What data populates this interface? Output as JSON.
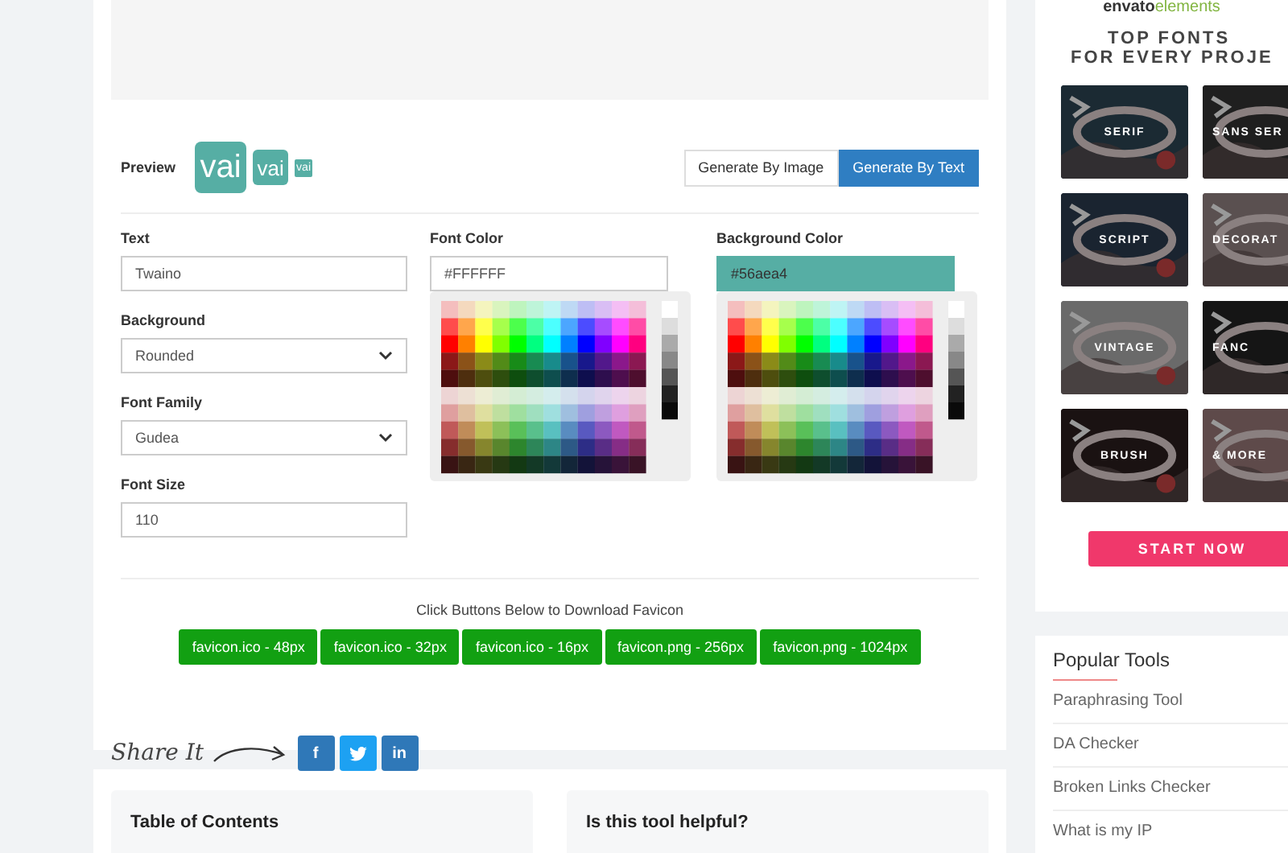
{
  "preview": {
    "label": "Preview",
    "icons": [
      "vai",
      "vai",
      "vai"
    ]
  },
  "mode_tabs": [
    {
      "label": "Generate By Image",
      "selected": false
    },
    {
      "label": "Generate By Text",
      "selected": true
    }
  ],
  "form": {
    "text": {
      "label": "Text",
      "value": "Twaino"
    },
    "background": {
      "label": "Background",
      "value": "Rounded"
    },
    "font_family": {
      "label": "Font Family",
      "value": "Gudea"
    },
    "font_size": {
      "label": "Font Size",
      "value": "110"
    },
    "font_color": {
      "label": "Font Color",
      "value": "#FFFFFF"
    },
    "background_color": {
      "label": "Background Color",
      "value": "#56aea4"
    }
  },
  "download": {
    "hint": "Click Buttons Below to Download Favicon",
    "buttons": [
      "favicon.ico - 48px",
      "favicon.ico - 32px",
      "favicon.ico - 16px",
      "favicon.png - 256px",
      "favicon.png - 1024px"
    ]
  },
  "share": {
    "label": "Share It",
    "buttons": [
      {
        "kind": "facebook",
        "label": "f"
      },
      {
        "kind": "twitter"
      },
      {
        "kind": "linkedin",
        "label": "in"
      }
    ]
  },
  "bottom_cards": [
    "Table of Contents",
    "Is this tool helpful?"
  ],
  "ad": {
    "logo": [
      "envato",
      "elements"
    ],
    "headline": [
      "TOP FONTS",
      "FOR EVERY PROJE"
    ],
    "tiles": [
      {
        "label": "SERIF"
      },
      {
        "label": "SANS SER"
      },
      {
        "label": "SCRIPT"
      },
      {
        "label": "DECORAT"
      },
      {
        "label": "VINTAGE"
      },
      {
        "label": "FANC"
      },
      {
        "label": "BRUSH"
      },
      {
        "label": "& MORE"
      }
    ],
    "button": "START NOW"
  },
  "popular_tools": {
    "title": "Popular Tools",
    "items": [
      "Paraphrasing Tool",
      "DA Checker",
      "Broken Links Checker",
      "What is my IP"
    ]
  }
}
